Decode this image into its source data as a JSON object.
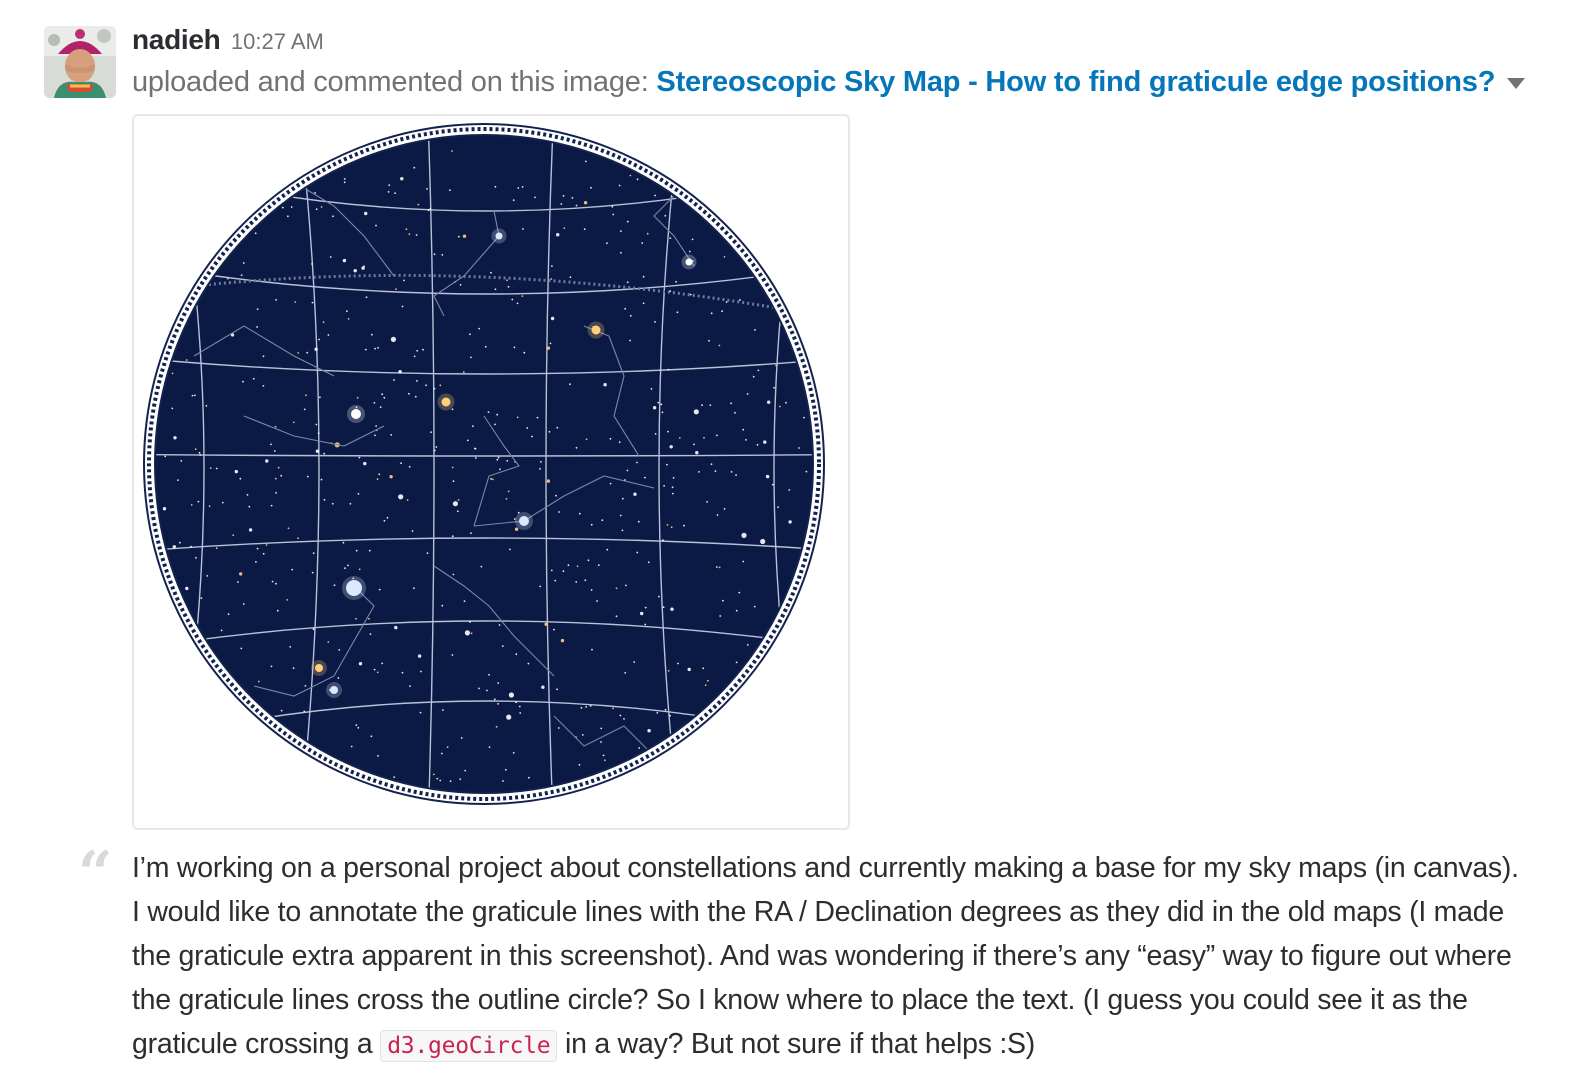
{
  "message": {
    "username": "nadieh",
    "timestamp": "10:27 AM",
    "action_text": "uploaded and commented on this image: ",
    "file_title": "Stereoscopic Sky Map - How to find graticule edge positions?",
    "comment": {
      "text_before_code": "I’m working on a personal project about constellations and currently making a base for my sky maps (in canvas). I would like to annotate the graticule lines with the RA / Declination degrees as they did in the old maps (I made the graticule extra apparent in this screenshot). And was wondering if there’s any “easy” way to figure out where the graticule lines cross the outline circle? So I know where to place the text. (I guess you could see it as the graticule crossing a ",
      "code": "d3.geoCircle",
      "text_after_code": " in a way? But not sure if that helps :S)"
    }
  },
  "icons": {
    "dropdown": "caret-down-icon",
    "quote": "quote-icon"
  },
  "colors": {
    "link": "#0576b9",
    "sky_background": "#0b1a45",
    "graticule": "#b8c1d8",
    "code_text": "#c7254e"
  }
}
